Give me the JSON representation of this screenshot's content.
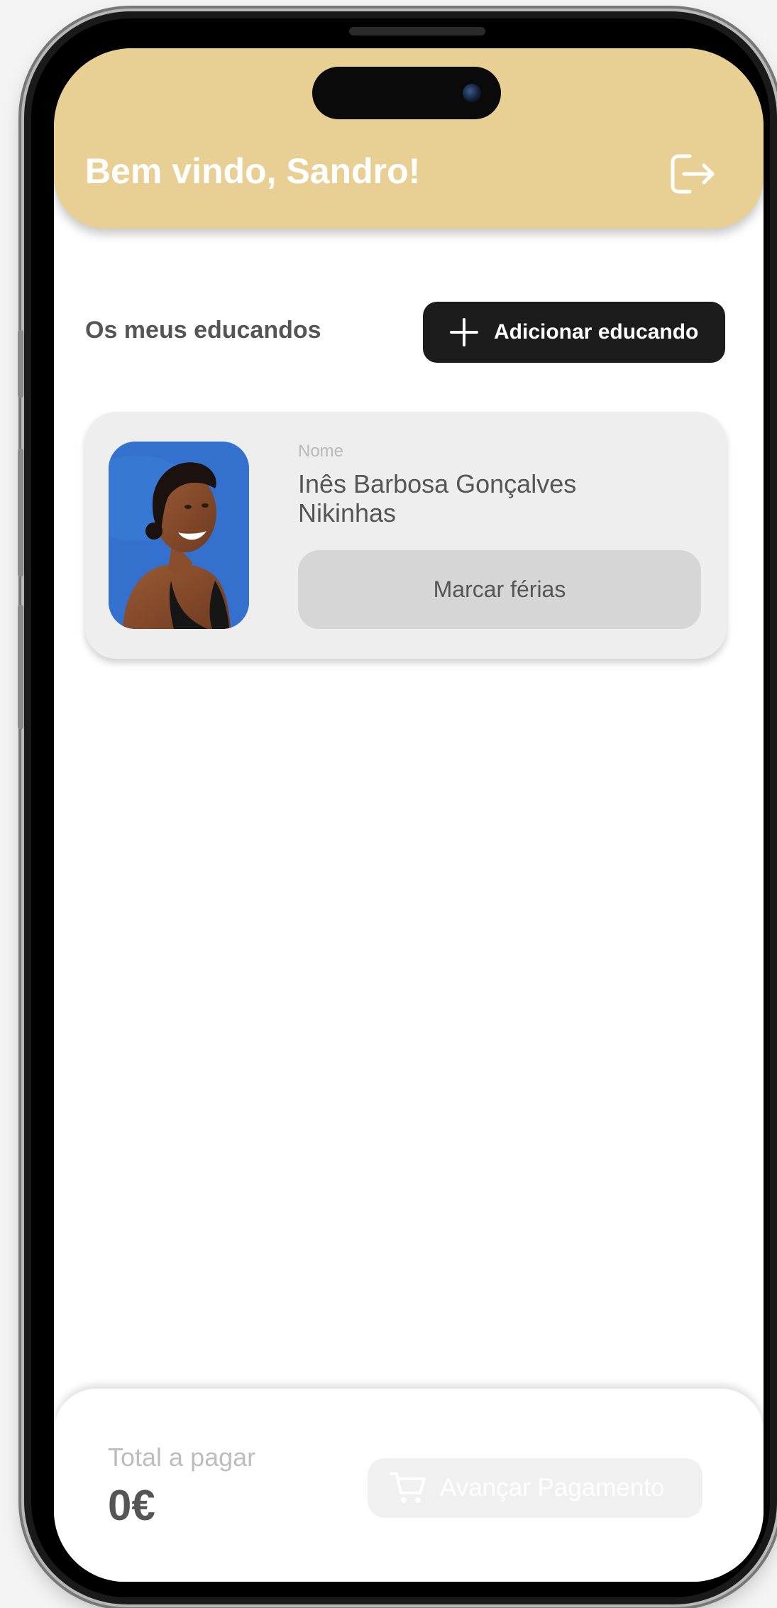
{
  "header": {
    "greeting": "Bem vindo, Sandro!",
    "logout_icon": "logout-icon"
  },
  "students_section": {
    "title": "Os meus educandos",
    "add_button_label": "Adicionar educando",
    "add_icon": "plus-icon"
  },
  "students": [
    {
      "name_caption": "Nome",
      "name": "Inês Barbosa Gonçalves Nikinhas",
      "vacation_button_label": "Marcar férias"
    }
  ],
  "payment": {
    "total_label": "Total a pagar",
    "total_value": "0€",
    "pay_button_label": "Avançar Pagamento",
    "pay_button_disabled": true,
    "cart_icon": "cart-icon"
  },
  "colors": {
    "header_background": "#e8cf94",
    "primary_button": "#1c1c1c",
    "card_background": "#eeeeee",
    "secondary_button": "#d6d6d6",
    "text_primary": "#555555",
    "text_muted": "#b9b9b9"
  }
}
